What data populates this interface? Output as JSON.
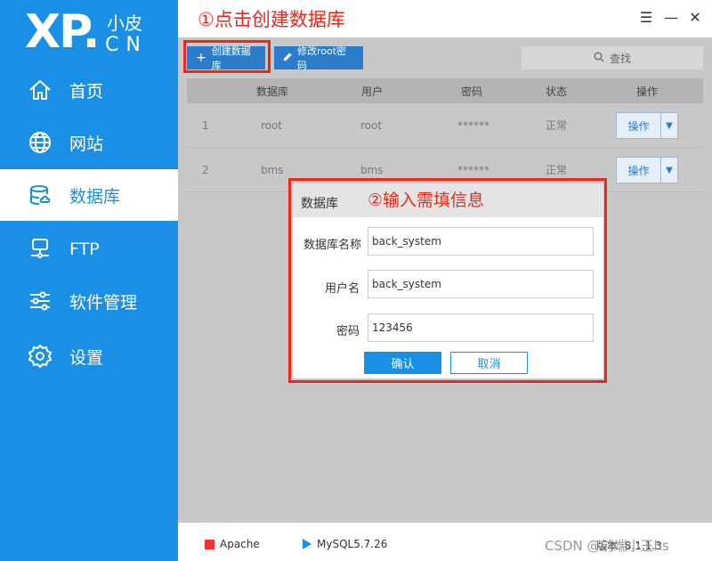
{
  "logo": {
    "brand": "XP.",
    "sub_cn": "小皮",
    "sub_en": "CN"
  },
  "sidebar": {
    "items": [
      {
        "label": "首页",
        "icon": "home-icon"
      },
      {
        "label": "网站",
        "icon": "globe-icon"
      },
      {
        "label": "数据库",
        "icon": "database-icon",
        "active": true
      },
      {
        "label": "FTP",
        "icon": "ftp-icon"
      },
      {
        "label": "软件管理",
        "icon": "sliders-icon"
      },
      {
        "label": "设置",
        "icon": "gear-icon"
      }
    ]
  },
  "annotations": {
    "step1": "①点击创建数据库",
    "step2": "②输入需填信息"
  },
  "toolbar": {
    "create_label": "创建数据库",
    "change_pw_label": "修改root密码",
    "search_placeholder": "查找"
  },
  "table": {
    "headers": [
      "数据库",
      "用户",
      "密码",
      "状态",
      "操作"
    ],
    "rows": [
      {
        "index": "1",
        "db": "root",
        "user": "root",
        "password": "******",
        "status": "正常",
        "action": "操作"
      },
      {
        "index": "2",
        "db": "bms",
        "user": "bms",
        "password": "******",
        "status": "正常",
        "action": "操作"
      }
    ]
  },
  "dialog": {
    "title": "数据库",
    "fields": [
      {
        "label": "数据库名称",
        "value": "back_system"
      },
      {
        "label": "用户名",
        "value": "back_system"
      },
      {
        "label": "密码",
        "value": "123456"
      }
    ],
    "ok_label": "确认",
    "cancel_label": "取消"
  },
  "statusbar": {
    "apache": "Apache",
    "mysql": "MySQL5.7.26",
    "version": "版本: 8.1.1.3"
  },
  "watermark": "CSDN @前端小王hs",
  "colors": {
    "primary": "#1a8fe6",
    "annotation": "#e8291c",
    "button": "#2b7dc9"
  }
}
